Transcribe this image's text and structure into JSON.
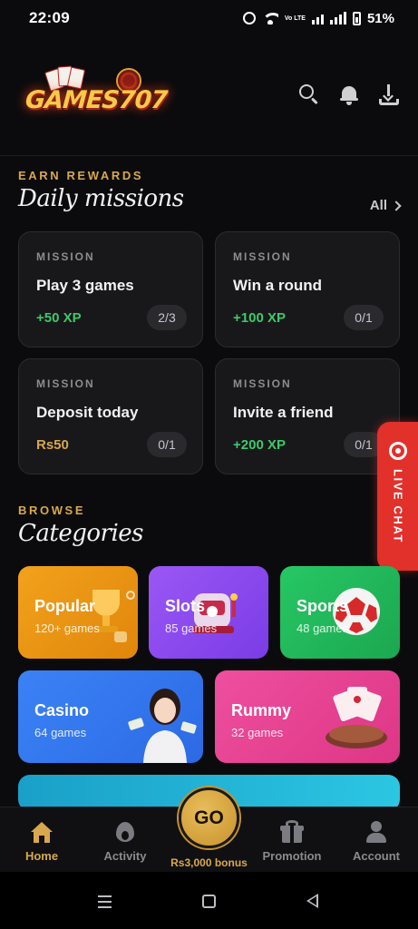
{
  "status_bar": {
    "time": "22:09",
    "network_label": "Vo LTE",
    "battery": "51%"
  },
  "header": {
    "logo_text": "GAMES707",
    "icons": [
      "search-icon",
      "bell-icon",
      "download-icon"
    ]
  },
  "rewards": {
    "eyebrow": "EARN REWARDS",
    "title": "Daily missions",
    "see_all": "All",
    "missions": [
      {
        "tag": "MISSION",
        "title": "Play 3 games",
        "reward": "+50 XP",
        "progress": "2/3"
      },
      {
        "tag": "MISSION",
        "title": "Win a round",
        "reward": "+100 XP",
        "progress": "0/1"
      },
      {
        "tag": "MISSION",
        "title": "Deposit today",
        "reward": "Rs50",
        "progress": "0/1"
      },
      {
        "tag": "MISSION",
        "title": "Invite a friend",
        "reward": "+200 XP",
        "progress": "0/1"
      }
    ]
  },
  "live_chat": {
    "label": "LIVE CHAT"
  },
  "browse": {
    "eyebrow": "BROWSE",
    "title": "Categories",
    "categories": [
      {
        "name": "Popular",
        "count": "120+ games",
        "color": "#f2a21c"
      },
      {
        "name": "Slots",
        "count": "85 games",
        "color": "#9b57f5"
      },
      {
        "name": "Sports",
        "count": "48 games",
        "color": "#27c765"
      },
      {
        "name": "Casino",
        "count": "64 games",
        "color": "#3b82f6"
      },
      {
        "name": "Rummy",
        "count": "32 games",
        "color": "#ee4f9e"
      }
    ]
  },
  "bottom_nav": {
    "items": [
      {
        "label": "Home",
        "icon": "home-icon",
        "active": true
      },
      {
        "label": "Activity",
        "icon": "flame-icon",
        "active": false
      },
      {
        "label": "Promotion",
        "icon": "gift-icon",
        "active": false
      },
      {
        "label": "Account",
        "icon": "account-icon",
        "active": false
      }
    ],
    "go_label": "GO",
    "go_bonus": "Rs3,000 bonus"
  },
  "colors": {
    "accent_gold": "#d8a84c",
    "reward_green": "#3ec96a",
    "live_chat_red": "#e2302b",
    "background": "#0b0b0d"
  }
}
